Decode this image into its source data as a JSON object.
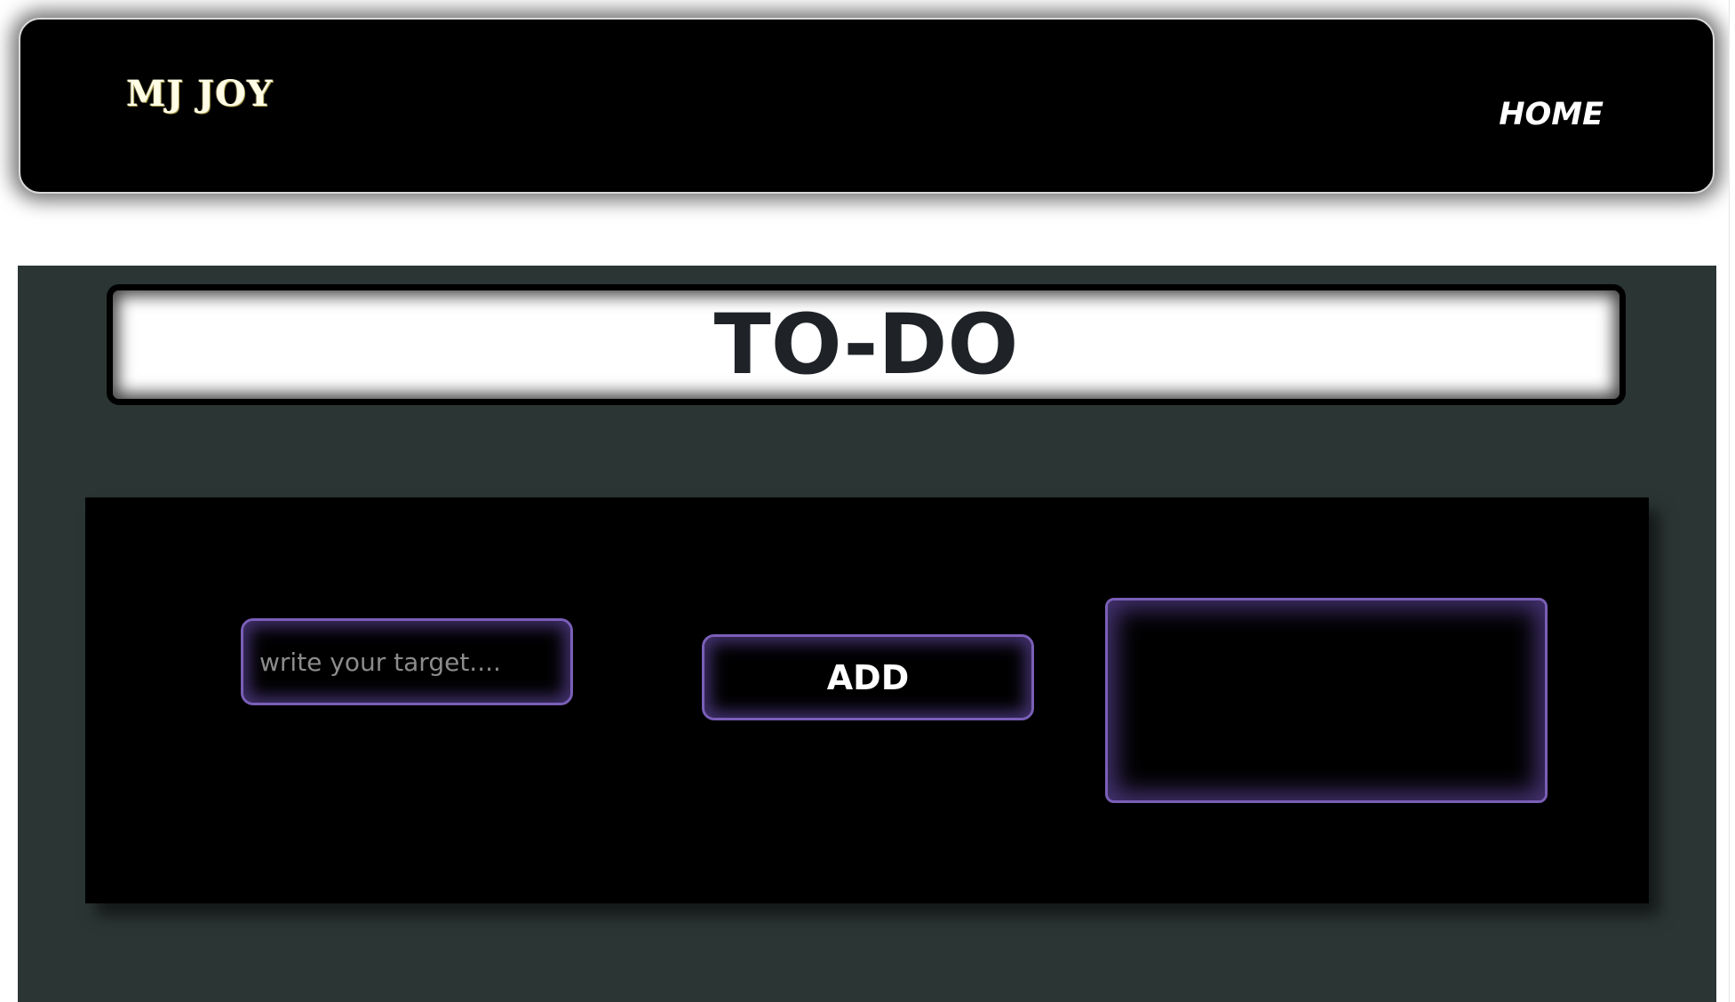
{
  "navbar": {
    "brand": "MJ JOY",
    "home_link": "HOME"
  },
  "main": {
    "title": "TO-DO",
    "input": {
      "value": "",
      "placeholder": "write your target...."
    },
    "add_button_label": "ADD",
    "task_list": []
  },
  "colors": {
    "navbar_bg": "#000000",
    "page_bg": "#2b3634",
    "panel_bg": "#000000",
    "accent_glow": "#7a5fb8",
    "title_text": "#1f2328",
    "brand_text": "#fffde6"
  }
}
